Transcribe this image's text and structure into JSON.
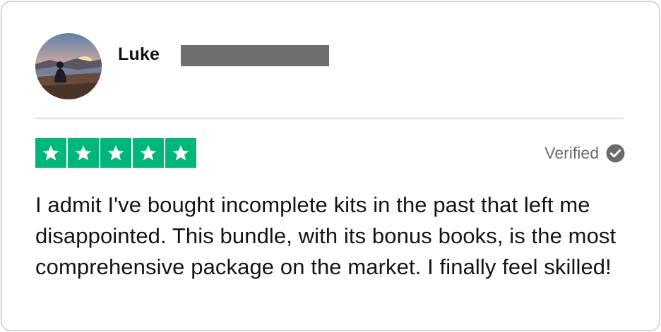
{
  "review": {
    "reviewer_name": "Luke",
    "reviewer_surname_redacted": true,
    "rating": 5,
    "rating_max": 5,
    "verified_label": "Verified",
    "body": "I admit I've bought incomplete kits in the past that left me disappointed. This bundle, with its bonus books, is the most comprehensive package on the market. I finally feel skilled!"
  },
  "icons": {
    "avatar": "avatar-photo",
    "star": "star-icon",
    "verified": "check-circle-icon"
  },
  "colors": {
    "star_background": "#00b67a",
    "redaction_bar": "#6f6f6f",
    "verified_text": "#6b6b6b"
  }
}
